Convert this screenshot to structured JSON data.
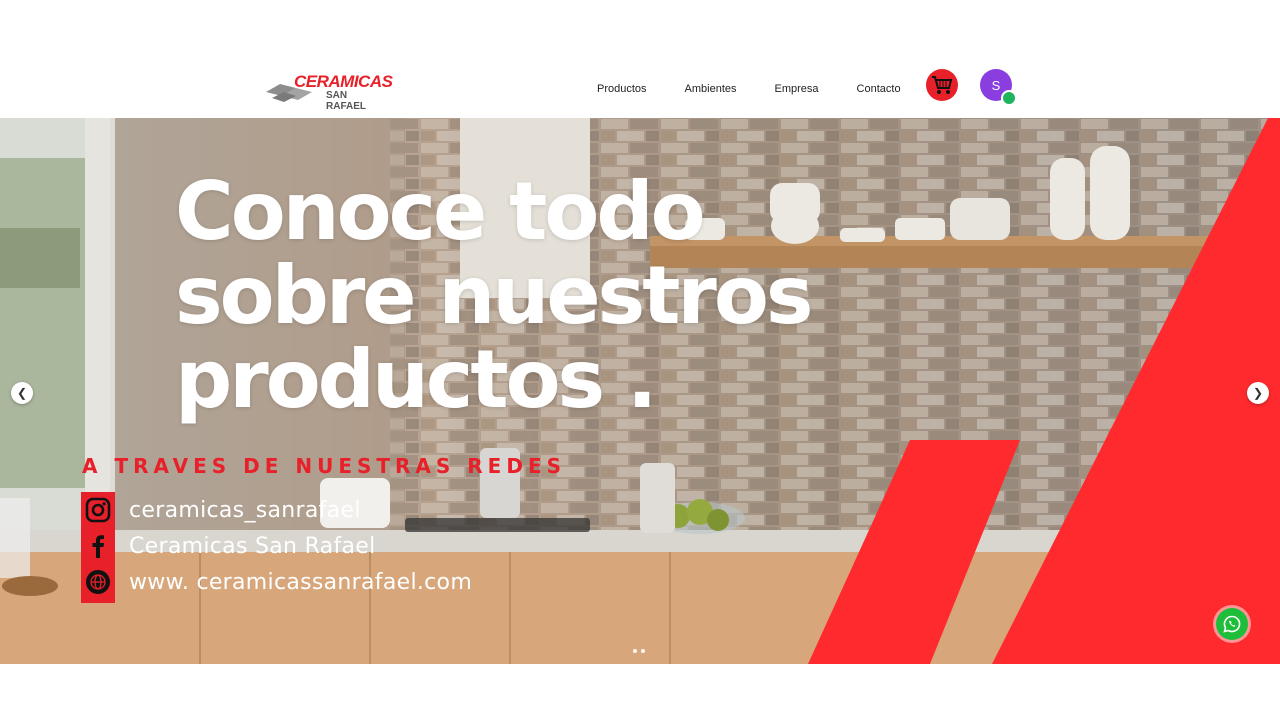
{
  "header": {
    "logo": {
      "line1": "CERAMICAS",
      "line2": "SAN RAFAEL"
    },
    "nav": [
      {
        "label": "Productos"
      },
      {
        "label": "Ambientes"
      },
      {
        "label": "Empresa"
      },
      {
        "label": "Contacto"
      }
    ],
    "cart_icon": "cart-icon",
    "avatar_initial": "S",
    "colors": {
      "brand_red": "#e8202a",
      "avatar": "#8a3ee0",
      "online": "#1fb55f"
    }
  },
  "hero": {
    "headline": [
      "Conoce todo",
      "sobre nuestros",
      "productos ."
    ],
    "subheading": "A TRAVES DE NUESTRAS REDES",
    "social": [
      {
        "icon": "instagram-icon",
        "text": "ceramicas_sanrafael"
      },
      {
        "icon": "facebook-icon",
        "text": "Ceramicas San Rafael"
      },
      {
        "icon": "globe-icon",
        "text": "www. ceramicassanrafael.com"
      }
    ],
    "prev_icon": "chevron-left-icon",
    "next_icon": "chevron-right-icon",
    "slide_count": 2
  },
  "whatsapp_icon": "whatsapp-icon"
}
